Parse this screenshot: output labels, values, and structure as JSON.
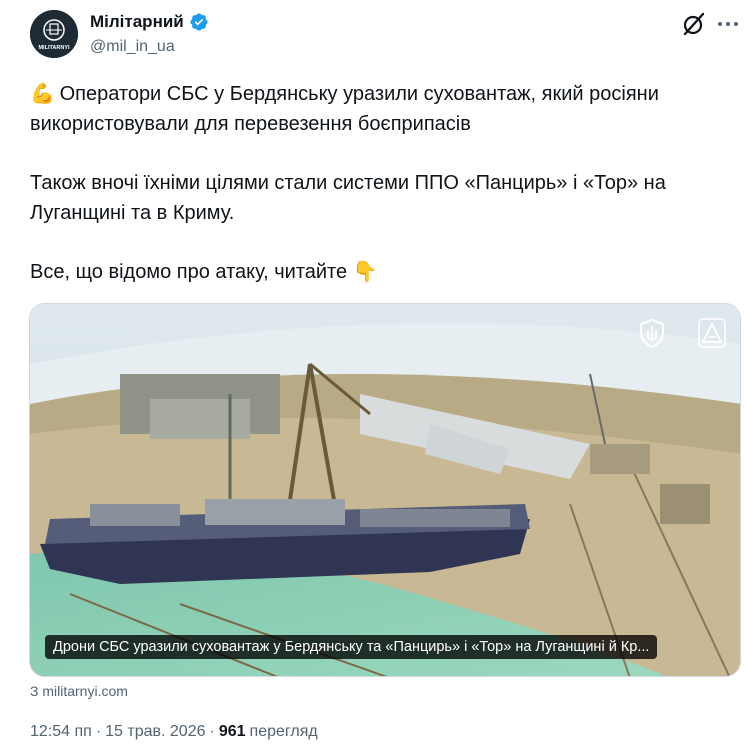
{
  "author": {
    "display_name": "Мілітарний",
    "handle": "@mil_in_ua",
    "avatar_icon": "militarnyi-logo-avatar",
    "avatar_text": "MILITARNYI",
    "verified_color": "#1d9bf0"
  },
  "tweet": {
    "line1_emoji": "💪",
    "line1": "Оператори СБС у Бердянську уразили суховантаж, який росіяни",
    "line2": "використовували для перевезення боєприпасів",
    "line3": "Також вночі їхніми цілями стали системи ППО «Панцирь» і «Тор» на",
    "line4": "Луганщині та в Криму.",
    "line5": "Все, що відомо про атаку, читайте",
    "line5_emoji": "👇"
  },
  "media": {
    "caption": "Дрони СБС уразили суховантаж у Бердянську та «Панцирь» і «Тор» на Луганщині й Кр...",
    "badges": [
      "shield-icon",
      "warning-icon"
    ]
  },
  "link": {
    "source": "З militarnyi.com"
  },
  "meta": {
    "time": "12:54 пп",
    "separator": "·",
    "date": "15 трав. 2026",
    "views_count": "961",
    "views_label": "перегляд"
  },
  "colors": {
    "text": "#0f1419",
    "secondary": "#536471",
    "accent": "#1d9bf0"
  }
}
